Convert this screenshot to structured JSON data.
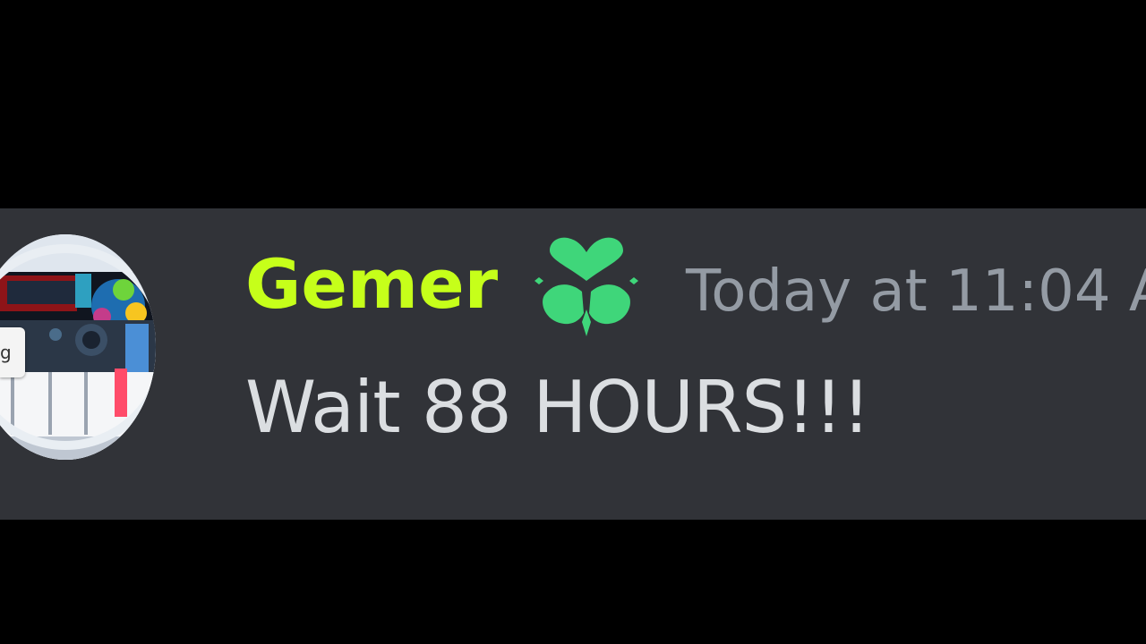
{
  "message": {
    "author": "Gemer",
    "timestamp": "Today at 11:04 A",
    "content": "Wait 88 HOURS!!!",
    "author_color": "#c6ff1a",
    "role_icon": "green-heart-lotus-icon",
    "role_icon_color": "#3fd67a"
  },
  "tooltip": {
    "text": "g"
  },
  "colors": {
    "background": "#000000",
    "message_bg": "#313338",
    "timestamp": "#949ba4",
    "content": "#dbdee1"
  }
}
